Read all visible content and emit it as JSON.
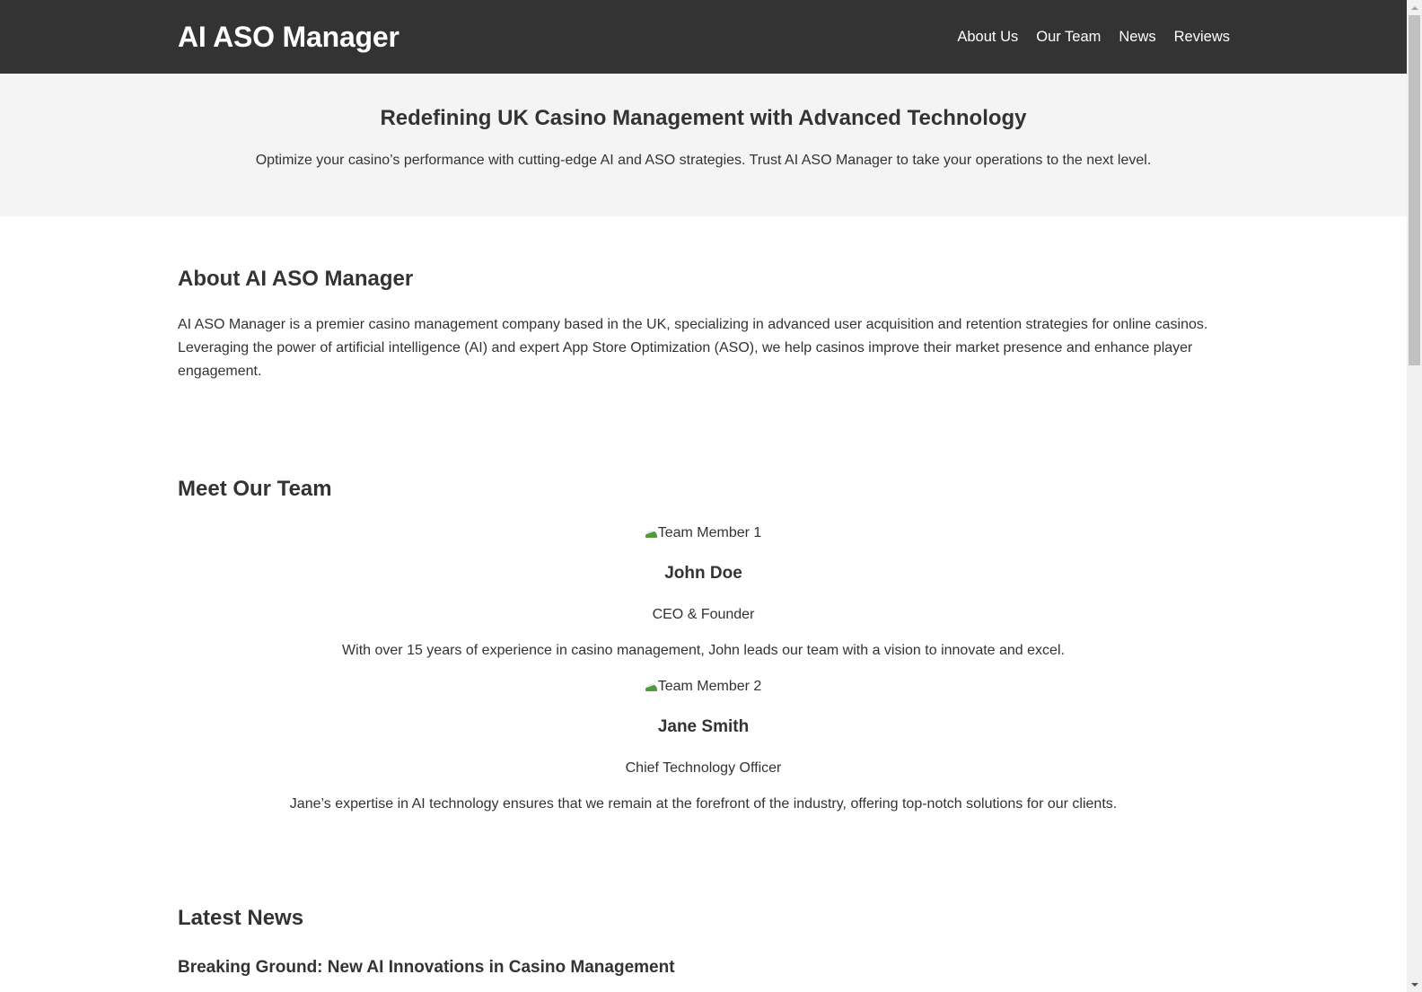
{
  "header": {
    "logo": "AI ASO Manager",
    "nav": [
      {
        "label": "About Us"
      },
      {
        "label": "Our Team"
      },
      {
        "label": "News"
      },
      {
        "label": "Reviews"
      }
    ]
  },
  "hero": {
    "title": "Redefining UK Casino Management with Advanced Technology",
    "subtitle": "Optimize your casino’s performance with cutting-edge AI and ASO strategies. Trust AI ASO Manager to take your operations to the next level."
  },
  "about": {
    "title": "About AI ASO Manager",
    "body": "AI ASO Manager is a premier casino management company based in the UK, specializing in advanced user acquisition and retention strategies for online casinos. Leveraging the power of artificial intelligence (AI) and expert App Store Optimization (ASO), we help casinos improve their market presence and enhance player engagement."
  },
  "team": {
    "title": "Meet Our Team",
    "members": [
      {
        "image_alt": "Team Member 1",
        "name": "John Doe",
        "role": "CEO & Founder",
        "bio": "With over 15 years of experience in casino management, John leads our team with a vision to innovate and excel."
      },
      {
        "image_alt": "Team Member 2",
        "name": "Jane Smith",
        "role": "Chief Technology Officer",
        "bio": "Jane’s expertise in AI technology ensures that we remain at the forefront of the industry, offering top-notch solutions for our clients."
      }
    ]
  },
  "news": {
    "title": "Latest News",
    "articles": [
      {
        "title": "Breaking Ground: New AI Innovations in Casino Management"
      }
    ]
  }
}
